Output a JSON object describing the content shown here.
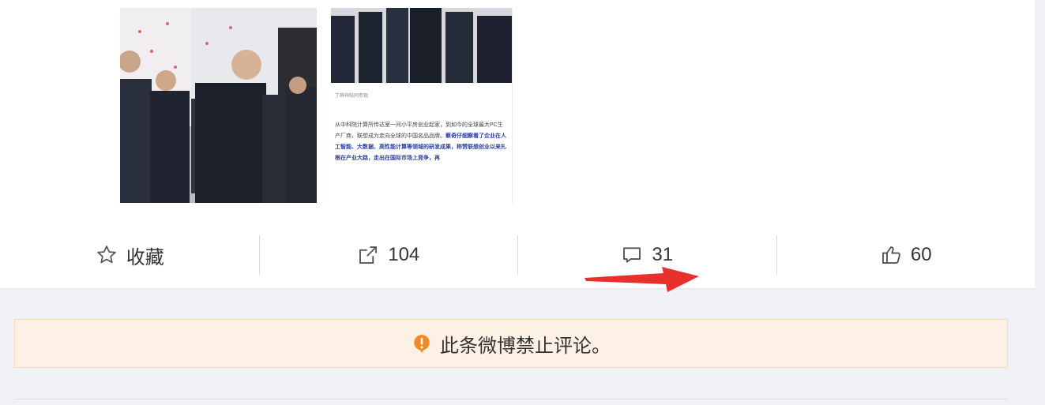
{
  "post": {
    "image_caption_small": "丁薛祥陪同参观",
    "article_text_plain": "从中科院计算所传达室一间小平房创业起家，到如今的全球最大PC生产厂商，联想成为走向全球的中国名品品牌。",
    "article_text_highlight": "蔡奇仔细察看了企业在人工智能、大数据、高性能计算等领域的研发成果，称赞联想创业以来扎根在产业大路，走出在国际市场上竞争，再"
  },
  "actions": {
    "favorite_label": "收藏",
    "repost_count": "104",
    "comment_count": "31",
    "like_count": "60"
  },
  "notice": {
    "text": "此条微博禁止评论。"
  },
  "colors": {
    "page_bg": "#f0f1f5",
    "notice_bg": "#fdf0e4",
    "notice_icon": "#f08a24",
    "arrow": "#e8302c"
  }
}
